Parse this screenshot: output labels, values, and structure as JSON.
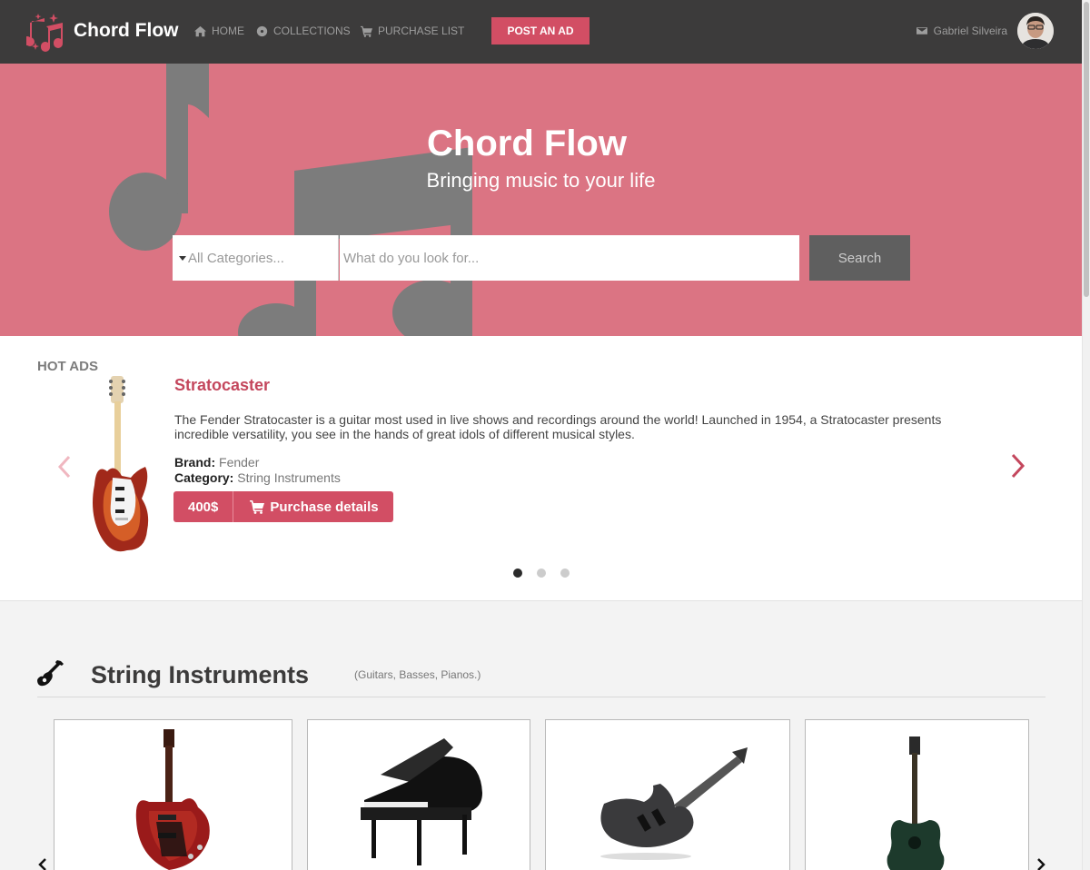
{
  "nav": {
    "brand": "Chord Flow",
    "links": [
      "HOME",
      "COLLECTIONS",
      "PURCHASE LIST"
    ],
    "post_ad": "POST AN AD",
    "user_name": "Gabriel Silveira"
  },
  "hero": {
    "title": "Chord Flow",
    "subtitle": "Bringing music to your life",
    "category_placeholder": "All Categories...",
    "search_placeholder": "What do you look for...",
    "search_button": "Search"
  },
  "hot_ads": {
    "label": "HOT ADS",
    "item": {
      "title": "Stratocaster",
      "description": "The Fender Stratocaster is a guitar most used in live shows and recordings around the world! Launched in 1954, a Stratocaster presents incredible versatility, you see in the hands of great idols of different musical styles.",
      "brand_label": "Brand:",
      "brand": "Fender",
      "category_label": "Category:",
      "category": "String Instruments",
      "price": "400$",
      "details_button": "Purchase details"
    },
    "slide_count": 3,
    "active_slide": 1
  },
  "section": {
    "title": "String Instruments",
    "subtitle": "(Guitars, Basses, Pianos.)",
    "products": [
      "electric-guitar",
      "grand-piano",
      "bass-guitar",
      "acoustic-guitar"
    ]
  },
  "colors": {
    "brand": "#d24e64",
    "hero_bg": "#db7483",
    "nav_bg": "#3c3b3b",
    "search_button": "#5f5f5f"
  },
  "icons": [
    "music-notes-logo-icon",
    "home-icon",
    "disc-icon",
    "cart-icon",
    "envelope-icon",
    "chevron-left-icon",
    "chevron-right-icon",
    "guitar-icon"
  ]
}
